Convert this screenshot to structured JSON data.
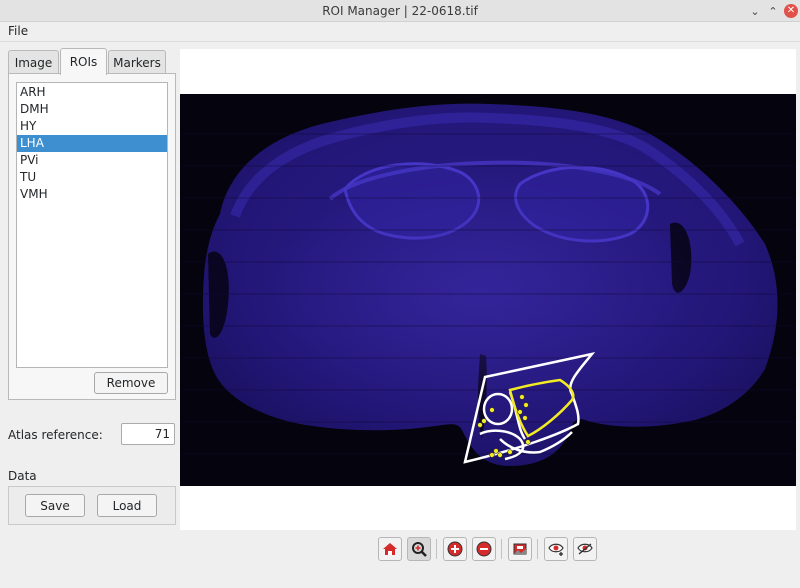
{
  "window": {
    "title": "ROI Manager  |  22-0618.tif",
    "minimize": "⌄",
    "maximize": "⌃",
    "close": "✕"
  },
  "menu": {
    "file": "File"
  },
  "tabs": [
    {
      "label": "Image",
      "active": false
    },
    {
      "label": "ROIs",
      "active": true
    },
    {
      "label": "Markers",
      "active": false
    }
  ],
  "roi_list": {
    "items": [
      "ARH",
      "DMH",
      "HY",
      "LHA",
      "PVi",
      "TU",
      "VMH"
    ],
    "selected": "LHA"
  },
  "buttons": {
    "remove": "Remove",
    "save": "Save",
    "load": "Load"
  },
  "atlas": {
    "label": "Atlas reference:",
    "value": "71"
  },
  "data_section": {
    "label": "Data"
  },
  "viewer": {
    "image": "fluorescence brain section",
    "roi_outline_color": "#ffffff",
    "selected_roi_color": "#f2ea22",
    "marker_color": "#f2ea22"
  },
  "toolbar": {
    "tools": [
      "home-icon",
      "zoom-region-icon",
      "zoom-in-icon",
      "zoom-out-icon",
      "save-image-icon",
      "show-markers-icon",
      "hide-markers-icon"
    ],
    "icon_color": "#d62b2b"
  }
}
